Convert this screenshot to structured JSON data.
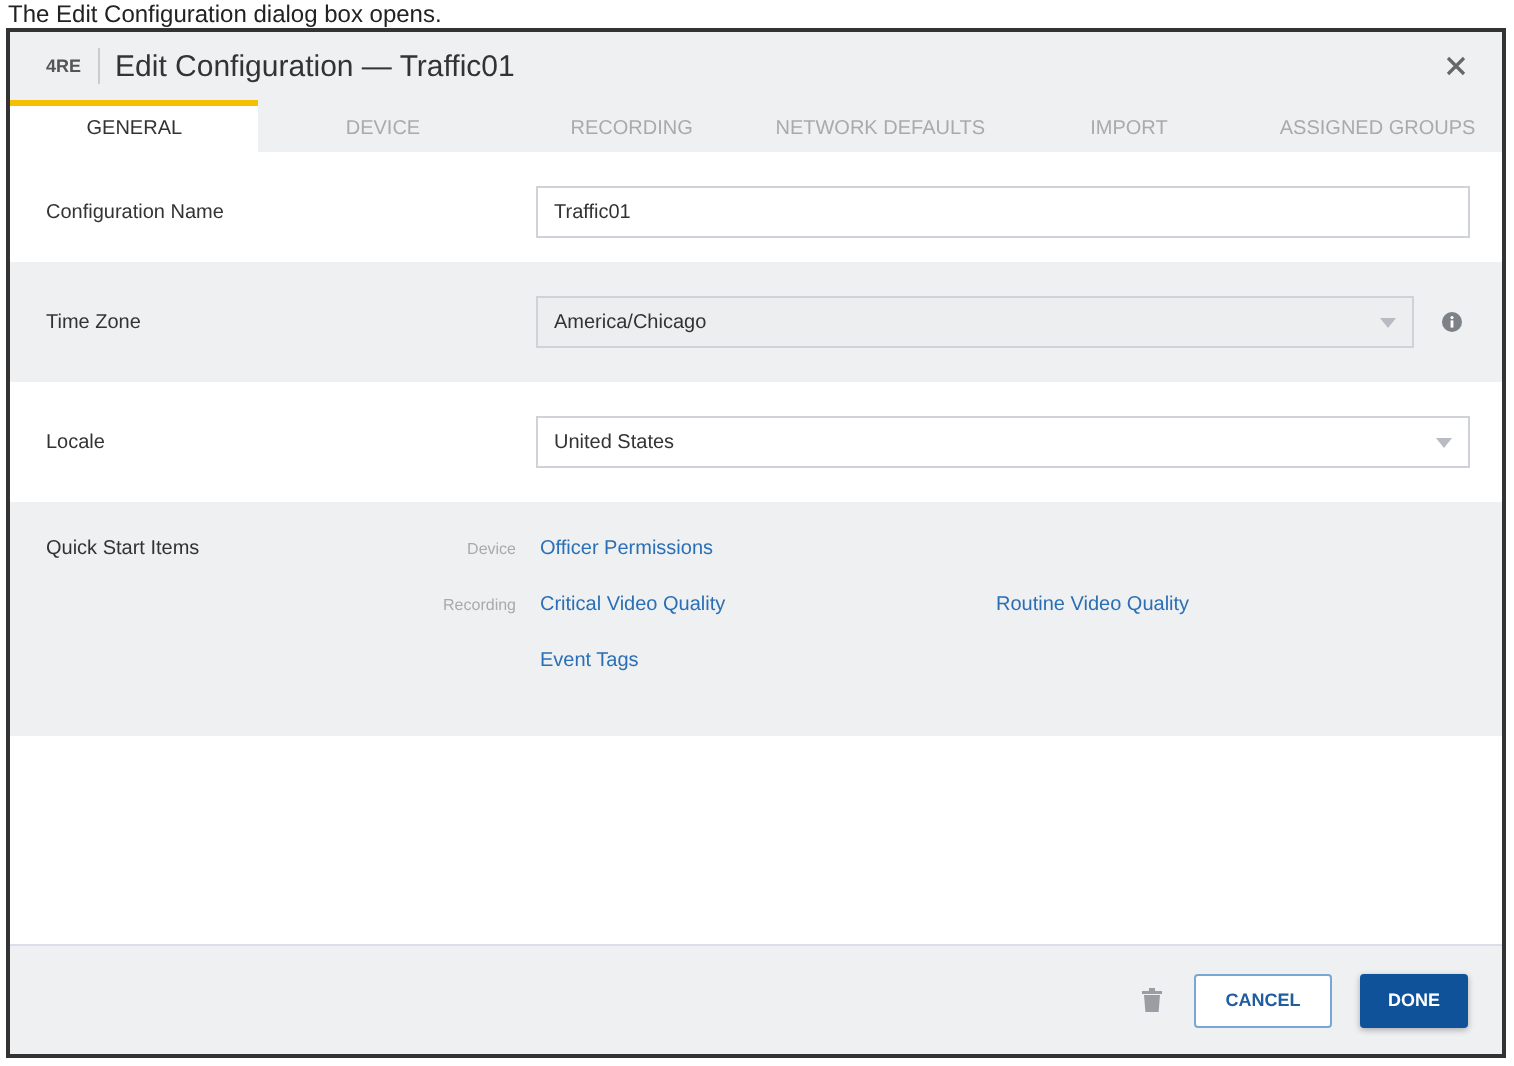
{
  "caption": "The Edit Configuration dialog box opens.",
  "dialog": {
    "logo": "4RE",
    "title": "Edit Configuration — Traffic01"
  },
  "tabs": [
    {
      "label": "GENERAL",
      "selected": true
    },
    {
      "label": "DEVICE",
      "selected": false
    },
    {
      "label": "RECORDING",
      "selected": false
    },
    {
      "label": "NETWORK DEFAULTS",
      "selected": false
    },
    {
      "label": "IMPORT",
      "selected": false
    },
    {
      "label": "ASSIGNED GROUPS",
      "selected": false
    }
  ],
  "fields": [
    {
      "label": "Configuration Name",
      "kind": "text",
      "value": "Traffic01",
      "disabled": false,
      "info": false
    },
    {
      "label": "Time Zone",
      "kind": "select",
      "value": "America/Chicago",
      "disabled": true,
      "info": true
    },
    {
      "label": "Locale",
      "kind": "select",
      "value": "United States",
      "disabled": false,
      "info": false
    }
  ],
  "quick_start": {
    "label": "Quick Start Items",
    "groups": [
      {
        "category": "Device",
        "links": [
          "Officer Permissions"
        ]
      },
      {
        "category": "Recording",
        "links": [
          "Critical Video Quality",
          "Routine Video Quality",
          "Event Tags"
        ]
      }
    ]
  },
  "footer": {
    "buttons": [
      {
        "label": "CANCEL",
        "kind": "secondary"
      },
      {
        "label": "DONE",
        "kind": "primary"
      }
    ]
  }
}
